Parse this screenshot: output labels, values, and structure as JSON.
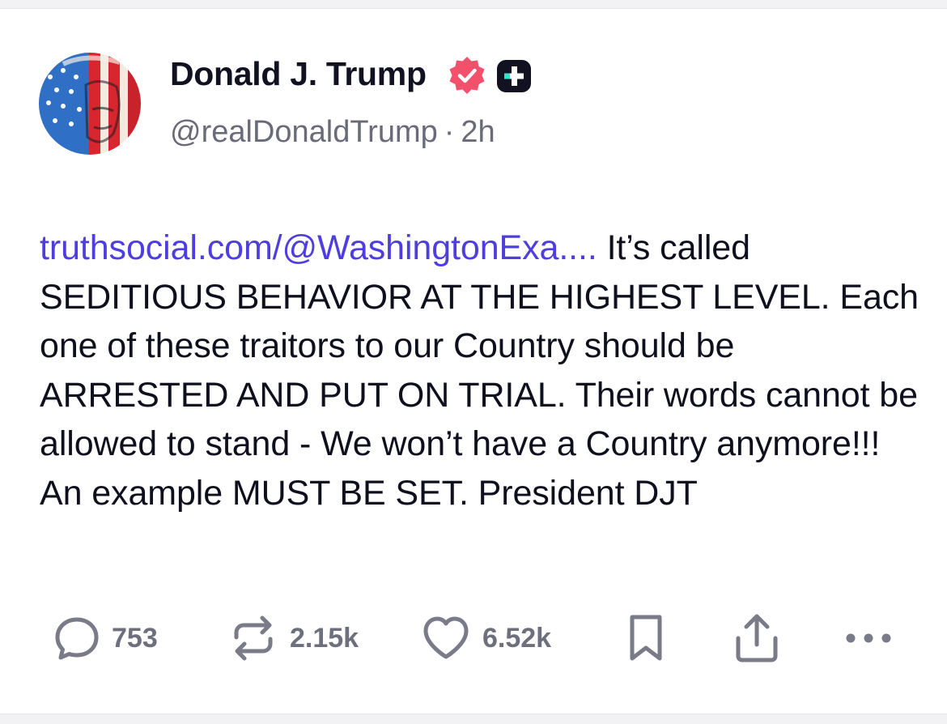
{
  "author": {
    "display_name": "Donald J. Trump",
    "handle": "@realDonaldTrump",
    "separator": "·",
    "time_ago": "2h",
    "verified_icon": "verified-badge-icon",
    "plus_icon": "truth-plus-badge-icon"
  },
  "post": {
    "link_text": "truthsocial.com/@WashingtonExa....",
    "body_text": " It’s called SEDITIOUS BEHAVIOR AT THE HIGHEST LEVEL. Each one of these traitors to our Country should be ARRESTED AND PUT ON TRIAL. Their words cannot be allowed to stand - We won’t have a Country anymore!!! An example MUST BE SET. President DJT"
  },
  "actions": {
    "replies": "753",
    "retruths": "2.15k",
    "likes": "6.52k"
  },
  "colors": {
    "link": "#4e3ee0",
    "verified": "#f3506b",
    "muted": "#7a7a88",
    "plus_badge_bg": "#111122",
    "plus_badge_accent": "#2ee6c8"
  }
}
